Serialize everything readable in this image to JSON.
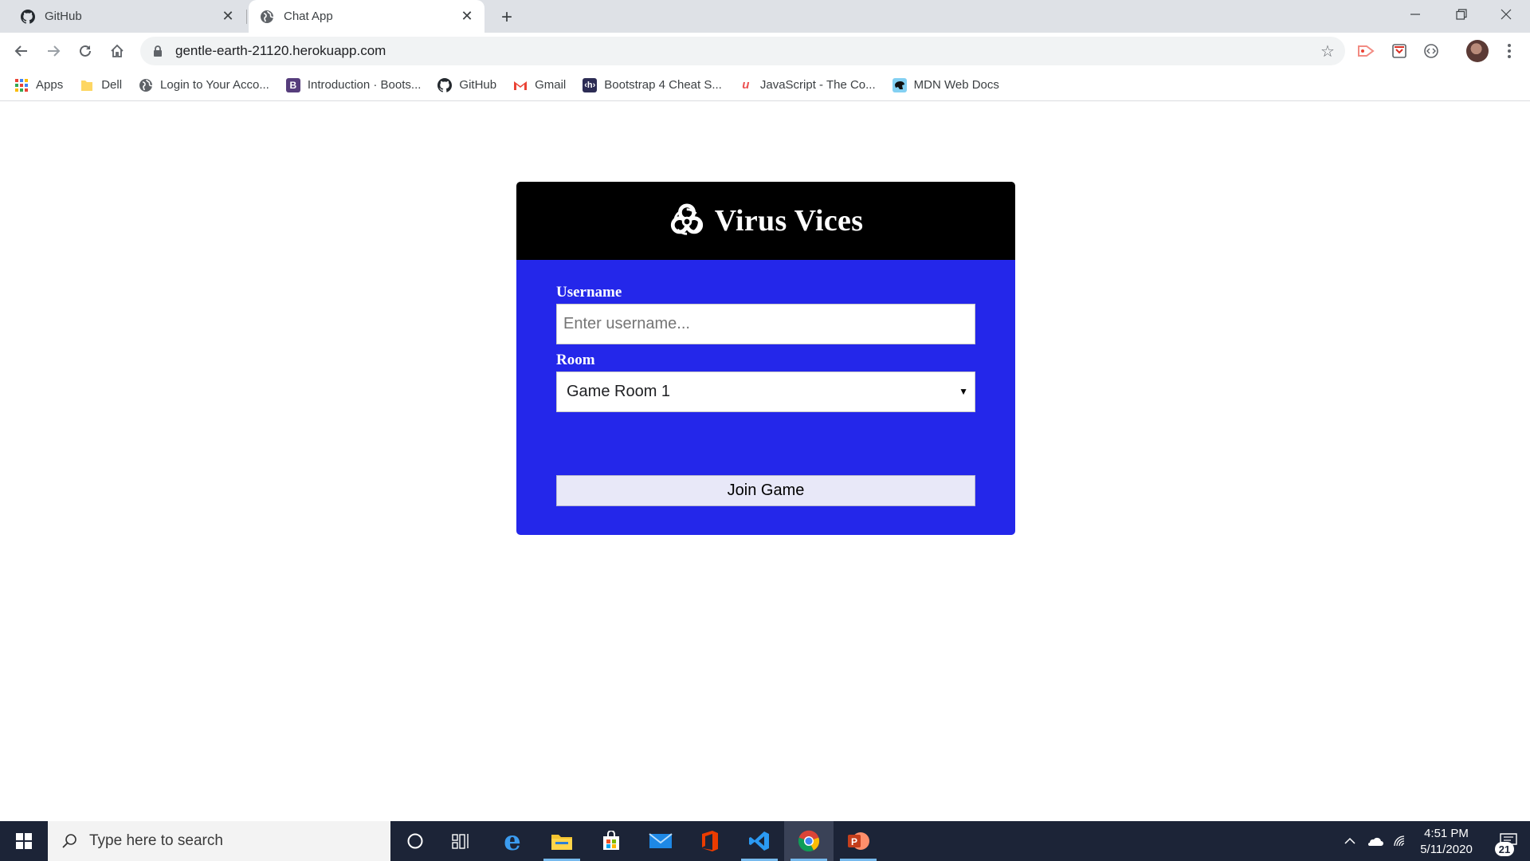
{
  "browser": {
    "tabs": [
      {
        "title": "GitHub",
        "active": false,
        "icon": "github-icon"
      },
      {
        "title": "Chat App",
        "active": true,
        "icon": "globe-icon"
      }
    ],
    "url": "gentle-earth-21120.herokuapp.com",
    "bookmarks": [
      {
        "label": "Apps",
        "icon": "apps-grid-icon"
      },
      {
        "label": "Dell",
        "icon": "folder-icon"
      },
      {
        "label": "Login to Your Acco...",
        "icon": "globe-icon"
      },
      {
        "label": "Introduction · Boots...",
        "icon": "bootstrap-icon"
      },
      {
        "label": "GitHub",
        "icon": "github-icon"
      },
      {
        "label": "Gmail",
        "icon": "gmail-icon"
      },
      {
        "label": "Bootstrap 4 Cheat S...",
        "icon": "hackerthemes-icon"
      },
      {
        "label": "JavaScript - The Co...",
        "icon": "udemy-icon"
      },
      {
        "label": "MDN Web Docs",
        "icon": "mdn-icon"
      }
    ]
  },
  "app": {
    "title": "Virus Vices",
    "username_label": "Username",
    "username_placeholder": "Enter username...",
    "username_value": "",
    "room_label": "Room",
    "room_selected": "Game Room 1",
    "join_label": "Join Game"
  },
  "taskbar": {
    "search_placeholder": "Type here to search",
    "time": "4:51 PM",
    "date": "5/11/2020",
    "notification_count": "21"
  },
  "colors": {
    "card_header": "#000000",
    "card_body": "#2427ea",
    "join_button": "#e8e8f8",
    "taskbar": "#1c2437"
  }
}
